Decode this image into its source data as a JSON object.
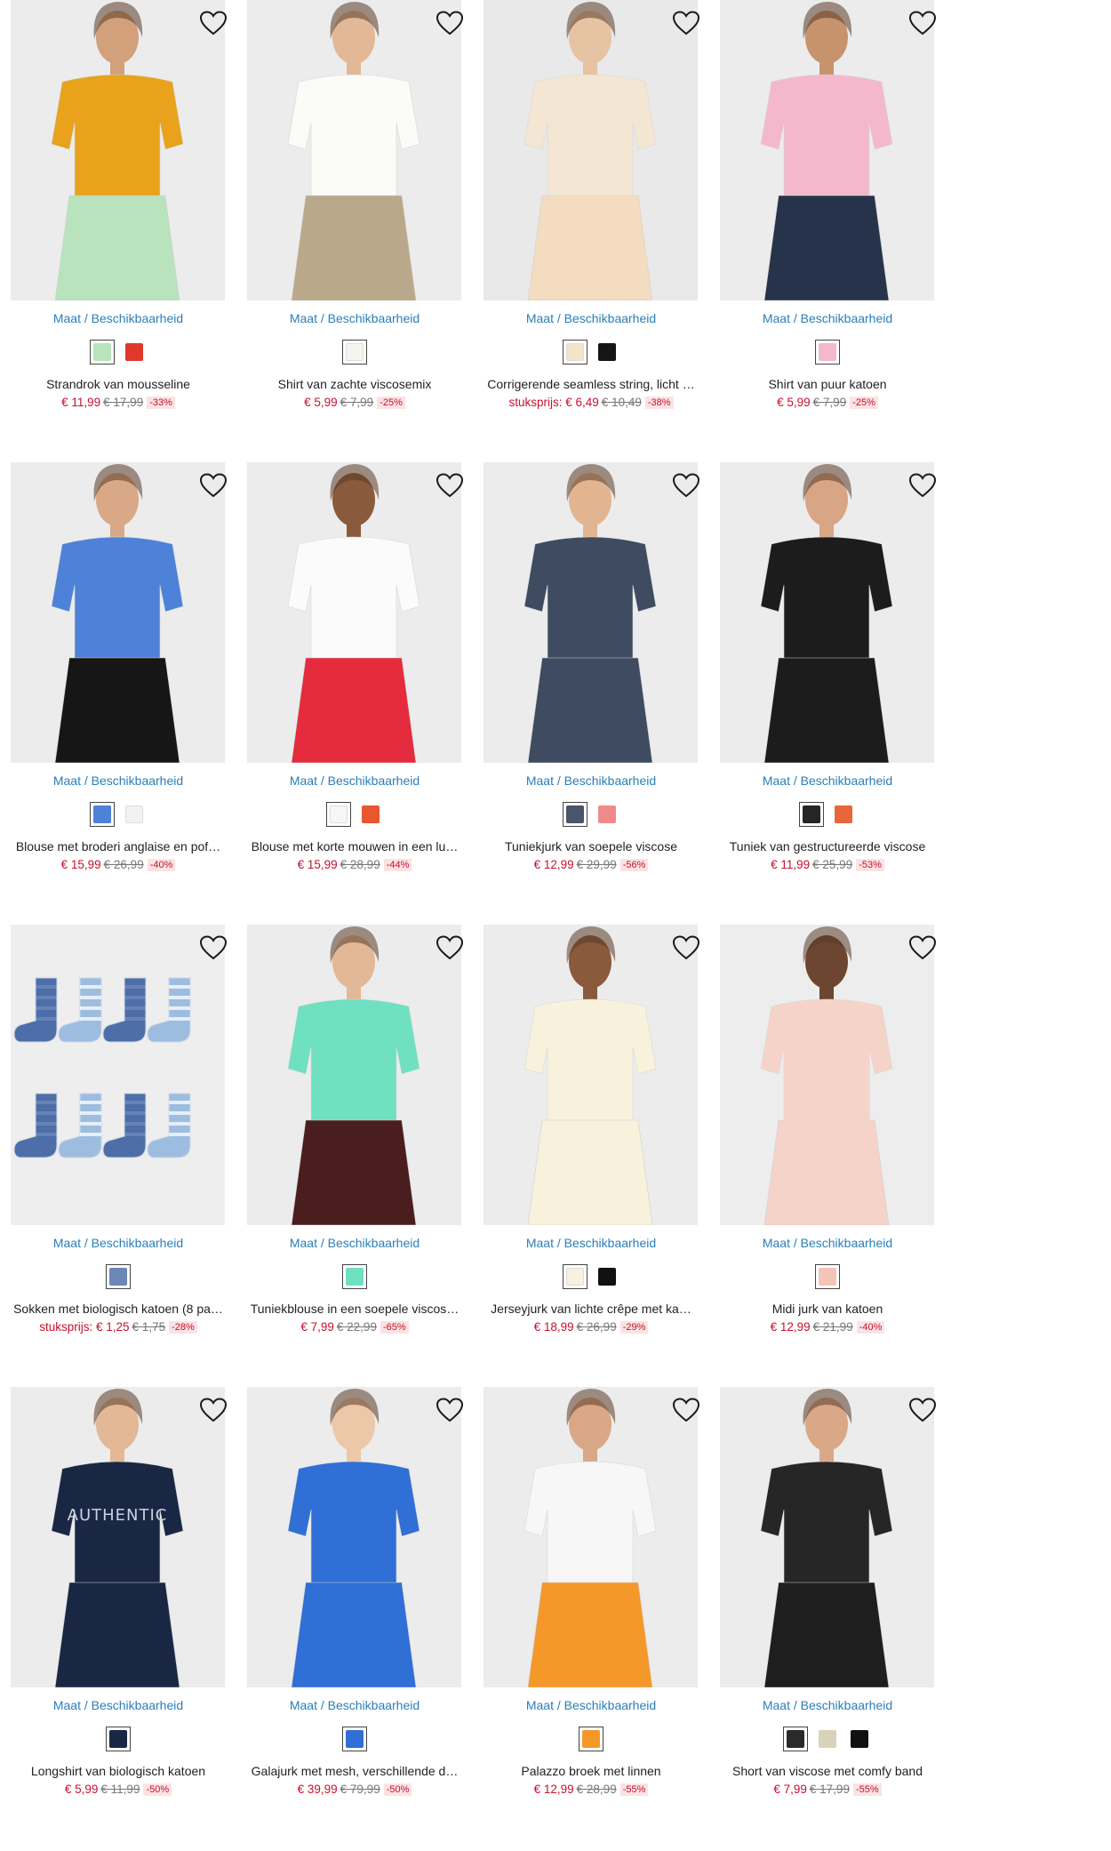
{
  "products": [
    {
      "name": "Strandrok van mousseline",
      "link": "Maat / Beschikbaarheid",
      "price": "€ 11,99",
      "old_price": "€ 17,99",
      "discount": "-33%",
      "bg": "#ececec",
      "top": "#e8a21c",
      "bottom": "#b9e3bc",
      "skin": "#d2a07a",
      "swatches": [
        {
          "color": "#b9e3bc",
          "selected": true
        },
        {
          "color": "#e0392b",
          "selected": false
        }
      ]
    },
    {
      "name": "Shirt van zachte viscosemix",
      "link": "Maat / Beschikbaarheid",
      "price": "€ 5,99",
      "old_price": "€ 7,99",
      "discount": "-25%",
      "bg": "#ececec",
      "top": "#fbfbf8",
      "bottom": "#b9a98a",
      "skin": "#e2b896",
      "swatches": [
        {
          "color": "#f6f4ef",
          "selected": true
        }
      ]
    },
    {
      "name": "Corrigerende seamless string, licht …",
      "link": "Maat / Beschikbaarheid",
      "price_prefix": "stuksprijs:",
      "price": "€ 6,49",
      "old_price": "€ 10,49",
      "discount": "-38%",
      "bg": "#e9e9e9",
      "top": "#f3e6d3",
      "bottom": "#f3dcc0",
      "skin": "#e6c3a3",
      "swatches": [
        {
          "color": "#f3e3c8",
          "selected": true
        },
        {
          "color": "#151515",
          "selected": false
        }
      ]
    },
    {
      "name": "Shirt van puur katoen",
      "link": "Maat / Beschikbaarheid",
      "price": "€ 5,99",
      "old_price": "€ 7,99",
      "discount": "-25%",
      "bg": "#ececec",
      "top": "#f3b8cb",
      "bottom": "#27334a",
      "skin": "#c6936c",
      "swatches": [
        {
          "color": "#f3b8cb",
          "selected": true
        }
      ]
    },
    {
      "name": "Blouse met broderi anglaise en pof…",
      "link": "Maat / Beschikbaarheid",
      "price": "€ 15,99",
      "old_price": "€ 26,99",
      "discount": "-40%",
      "bg": "#ececec",
      "top": "#4d82d8",
      "bottom": "#161616",
      "skin": "#d9a887",
      "swatches": [
        {
          "color": "#4d82d8",
          "selected": true
        },
        {
          "color": "#f2f2f2",
          "selected": false
        }
      ]
    },
    {
      "name": "Blouse met korte mouwen in een lu…",
      "link": "Maat / Beschikbaarheid",
      "price": "€ 15,99",
      "old_price": "€ 28,99",
      "discount": "-44%",
      "bg": "#ececec",
      "top": "#fbfbfb",
      "bottom": "#e42c3e",
      "skin": "#8a5a3c",
      "swatches": [
        {
          "color": "#f6f6f6",
          "selected": true
        },
        {
          "color": "#e8572e",
          "selected": false
        }
      ]
    },
    {
      "name": "Tuniekjurk van soepele viscose",
      "link": "Maat / Beschikbaarheid",
      "price": "€ 12,99",
      "old_price": "€ 29,99",
      "discount": "-56%",
      "bg": "#ececec",
      "top": "#3e4b61",
      "bottom": "#3e4b61",
      "skin": "#e2b590",
      "swatches": [
        {
          "color": "#4a556b",
          "selected": true
        },
        {
          "color": "#f08a8a",
          "selected": false
        }
      ]
    },
    {
      "name": "Tuniek van gestructureerde viscose",
      "link": "Maat / Beschikbaarheid",
      "price": "€ 11,99",
      "old_price": "€ 25,99",
      "discount": "-53%",
      "bg": "#ececec",
      "top": "#1c1c1c",
      "bottom": "#1c1c1c",
      "skin": "#d8a585",
      "swatches": [
        {
          "color": "#262626",
          "selected": true
        },
        {
          "color": "#e8673a",
          "selected": false
        }
      ]
    },
    {
      "name": "Sokken met biologisch katoen (8 pa…",
      "link": "Maat / Beschikbaarheid",
      "price_prefix": "stuksprijs:",
      "price": "€ 1,25",
      "old_price": "€ 1,75",
      "discount": "-28%",
      "bg": "#eeeeee",
      "top": "#4d6ea8",
      "bottom": "#9dbde0",
      "skin": "#eeeeee",
      "socks": true,
      "swatches": [
        {
          "color": "#6c86b8",
          "selected": true
        }
      ]
    },
    {
      "name": "Tuniekblouse in een soepele viscos…",
      "link": "Maat / Beschikbaarheid",
      "price": "€ 7,99",
      "old_price": "€ 22,99",
      "discount": "-65%",
      "bg": "#ececec",
      "top": "#6fe0c0",
      "bottom": "#4a1e1e",
      "skin": "#e2b896",
      "swatches": [
        {
          "color": "#6fe0c0",
          "selected": true
        }
      ]
    },
    {
      "name": "Jerseyjurk van lichte crêpe met ka…",
      "link": "Maat / Beschikbaarheid",
      "price": "€ 18,99",
      "old_price": "€ 26,99",
      "discount": "-29%",
      "bg": "#ececec",
      "top": "#f8f1dc",
      "bottom": "#f8f1dc",
      "skin": "#8a5a3c",
      "swatches": [
        {
          "color": "#f8f1dc",
          "selected": true
        },
        {
          "color": "#111111",
          "selected": false
        }
      ]
    },
    {
      "name": "Midi jurk van katoen",
      "link": "Maat / Beschikbaarheid",
      "price": "€ 12,99",
      "old_price": "€ 21,99",
      "discount": "-40%",
      "bg": "#ededed",
      "top": "#f6d3c8",
      "bottom": "#f6d3c8",
      "skin": "#6d4631",
      "swatches": [
        {
          "color": "#f3c4b8",
          "selected": true
        }
      ]
    },
    {
      "name": "Longshirt van biologisch katoen",
      "link": "Maat / Beschikbaarheid",
      "price": "€ 5,99",
      "old_price": "€ 11,99",
      "discount": "-50%",
      "bg": "#ececec",
      "top": "#1a2744",
      "bottom": "#1a2744",
      "skin": "#e2b896",
      "print": "AUTHENTIC",
      "swatches": [
        {
          "color": "#1a2744",
          "selected": true
        }
      ]
    },
    {
      "name": "Galajurk met mesh, verschillende d…",
      "link": "Maat / Beschikbaarheid",
      "price": "€ 39,99",
      "old_price": "€ 79,99",
      "discount": "-50%",
      "bg": "#ececec",
      "top": "#2f6fd6",
      "bottom": "#2f6fd6",
      "skin": "#ecc7a8",
      "swatches": [
        {
          "color": "#2f6fd6",
          "selected": true
        }
      ]
    },
    {
      "name": "Palazzo broek met linnen",
      "link": "Maat / Beschikbaarheid",
      "price": "€ 12,99",
      "old_price": "€ 28,99",
      "discount": "-55%",
      "bg": "#ececec",
      "top": "#f7f7f7",
      "bottom": "#f5982a",
      "skin": "#d9a887",
      "swatches": [
        {
          "color": "#f5982a",
          "selected": true
        }
      ]
    },
    {
      "name": "Short van viscose met comfy band",
      "link": "Maat / Beschikbaarheid",
      "price": "€ 7,99",
      "old_price": "€ 17,99",
      "discount": "-55%",
      "bg": "#ececec",
      "top": "#262626",
      "bottom": "#1e1e1e",
      "skin": "#d9a887",
      "swatches": [
        {
          "color": "#2a2a2a",
          "selected": true
        },
        {
          "color": "#d8d2b8",
          "selected": false
        },
        {
          "color": "#111111",
          "selected": false
        }
      ]
    }
  ]
}
